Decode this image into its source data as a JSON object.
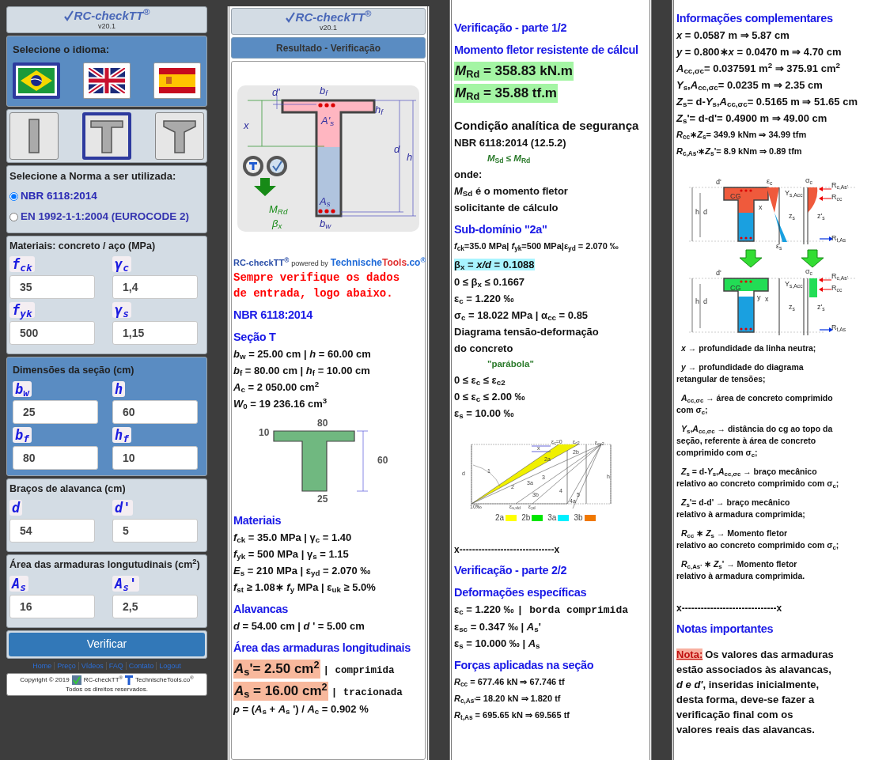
{
  "input_panel": {
    "header": {
      "title": "RC-checkTT$^{®}$",
      "version": "v20.1"
    },
    "language": {
      "label": "Selecione o idioma:",
      "flags": [
        {
          "kind": "brazil",
          "selected": true
        },
        {
          "kind": "uk",
          "selected": false
        },
        {
          "kind": "spain",
          "selected": false
        }
      ]
    },
    "sections": [
      {
        "kind": "rect",
        "selected": false
      },
      {
        "kind": "tee",
        "selected": true
      },
      {
        "kind": "tee-haunch",
        "selected": false
      }
    ],
    "norm": {
      "label": "Selecione a Norma a ser utilizada:",
      "options": [
        {
          "label": "NBR 6118:2014",
          "selected": true
        },
        {
          "label": "EN 1992-1-1:2004 (EUROCODE 2)",
          "selected": false
        }
      ]
    },
    "groups": [
      {
        "title": "Materiais: concreto / aço (MPa)",
        "highlighted": false,
        "fields": [
          {
            "symbol": "f$_{ck}$",
            "value": "35"
          },
          {
            "symbol": "γ$_{c}$",
            "value": "1,4"
          },
          {
            "symbol": "f$_{yk}$",
            "value": "500"
          },
          {
            "symbol": "γ$_{s}$",
            "value": "1,15"
          }
        ]
      },
      {
        "title": "Dimensões da seção (cm)",
        "highlighted": true,
        "fields": [
          {
            "symbol": "b$_{w}$",
            "value": "25"
          },
          {
            "symbol": "h",
            "value": "60"
          },
          {
            "symbol": "b$_{f}$",
            "value": "80"
          },
          {
            "symbol": "h$_{f}$",
            "value": "10"
          }
        ]
      },
      {
        "title": "Braços de alavanca (cm)",
        "highlighted": false,
        "fields": [
          {
            "symbol": "d",
            "value": "54"
          },
          {
            "symbol": "d'",
            "value": "5"
          }
        ]
      },
      {
        "title": "Área das armaduras longutudinais (cm$^{2}$)",
        "highlighted": false,
        "fields": [
          {
            "symbol": "A$_{s}$",
            "value": "16"
          },
          {
            "symbol": "A$_{s}$'",
            "value": "2,5"
          }
        ]
      }
    ],
    "button": "Verificar",
    "links": [
      "Home",
      "Preço",
      "Vídeos",
      "FAQ",
      "Contato",
      "Logout"
    ],
    "copyright": {
      "year": "Copyright © 2019",
      "app": "RC-checkTT$^{®}$",
      "site": "TechnischeTools.co$^{®}$",
      "rights": "Todos os direitos reservados."
    }
  },
  "results": {
    "header": {
      "title": "RC-checkTT$^{®}$",
      "version": "v20.1"
    },
    "title": "Resultado - Verificação",
    "columns": [
      [
        {
          "kind": "section-drawing",
          "labels": [
            "d'",
            "b$_{f}$",
            "h$_{f}$",
            "x",
            "A'$_{s}$",
            "d",
            "h",
            "A$_{s}$",
            "b$_{w}$",
            "M$_{Rd}$",
            "β$_{x}$"
          ]
        },
        {
          "kind": "credit",
          "app": "RC-checkTT$^{®}$",
          "by": "powered by",
          "site": "Technische",
          "site2": "Tools",
          "site3": ".co$^{®}$"
        },
        {
          "kind": "warning",
          "text": "Sempre verifique os dados\nde entrada, logo abaixo."
        },
        {
          "kind": "heading",
          "text": "NBR 6118:2014"
        },
        {
          "kind": "heading",
          "text": "Seção T"
        },
        {
          "kind": "line",
          "text": "*b*$_{w}$ = 25.00 cm | *h* = 60.00 cm"
        },
        {
          "kind": "line",
          "text": "*b*$_{f}$ = 80.00 cm | *h*$_{f}$ = 10.00 cm"
        },
        {
          "kind": "line",
          "text": "*A*$_{c}$ = 2 050.00 cm$^{2}$"
        },
        {
          "kind": "line",
          "text": "*W*$_{0}$ = 19 236.16 cm$^{3}$"
        },
        {
          "kind": "tee-drawing",
          "labels": [
            "80",
            "10",
            "60",
            "25"
          ]
        },
        {
          "kind": "heading",
          "text": "Materiais"
        },
        {
          "kind": "line",
          "text": "*f*$_{ck}$ = 35.0 MPa | γ$_{c}$ = 1.40"
        },
        {
          "kind": "line",
          "text": "*f*$_{yk}$ = 500 MPa | γ$_{s}$ = 1.15"
        },
        {
          "kind": "line",
          "text": "*E*$_{s}$ = 210 MPa | ε$_{yd}$ = 2.070 ‰"
        },
        {
          "kind": "line",
          "text": "*f*$_{st}$ ≥ 1.08∗ *f*$_{y}$ MPa | ε$_{uk}$ ≥ 5.0%"
        },
        {
          "kind": "heading",
          "text": "Alavancas"
        },
        {
          "kind": "line",
          "text": "*d* = 54.00 cm | *d* ' = 5.00 cm"
        },
        {
          "kind": "heading",
          "text": "Área das armaduras longitudinais"
        },
        {
          "kind": "result",
          "text": "*A*$_{s}$'= 2.50 cm$^{2}$",
          "note": "| comprimida",
          "color": "#f8b89c"
        },
        {
          "kind": "result",
          "text": "*A*$_{s}$ = 16.00 cm$^{2}$",
          "note": "| tracionada",
          "color": "#f8b89c"
        },
        {
          "kind": "line",
          "text": "*ρ* = (*A*$_{s}$ + *A*$_{s}$ ') / *A*$_{c}$ = 0.902 %"
        }
      ],
      [
        {
          "kind": "heading",
          "text": "Verificação - parte 1/2"
        },
        {
          "kind": "heading",
          "text": "Momento fletor resistente de cálcul"
        },
        {
          "kind": "result",
          "text": "*M*$_{Rd}$ = 358.83 kN.m",
          "color": "#a4f5a4"
        },
        {
          "kind": "result",
          "text": "*M*$_{Rd}$ = 35.88 tf.m",
          "color": "#a4f5a4"
        },
        {
          "kind": "subheading",
          "text": "Condição analítica de segurança"
        },
        {
          "kind": "line",
          "text": "NBR 6118:2014 (12.5.2)"
        },
        {
          "kind": "formula",
          "text": "*M*$_{Sd}$ ≤ *M*$_{Rd}$"
        },
        {
          "kind": "line",
          "text": "onde:"
        },
        {
          "kind": "line",
          "text": "*M*$_{Sd}$ é o momento fletor\nsolicitante de cálculo"
        },
        {
          "kind": "heading",
          "text": "Sub-domínio \"2a\""
        },
        {
          "kind": "small",
          "text": "*f*$_{ck}$=35.0 MPa| *f*$_{yk}$=500 MPa|ε$_{yd}$ = 2.070 ‰"
        },
        {
          "kind": "highlight",
          "text": "β$_{x}$ = *x/d* = 0.1088",
          "color": "#a8f4ff"
        },
        {
          "kind": "line",
          "text": "0 ≤ β$_{x}$ ≤ 0.1667"
        },
        {
          "kind": "line",
          "text": "ε$_{c}$ = 1.220 ‰"
        },
        {
          "kind": "line",
          "text": "σ$_{c}$ = 18.022 MPa | α$_{cc}$ = 0.85"
        },
        {
          "kind": "line",
          "text": "Diagrama tensão-deformação\ndo concreto"
        },
        {
          "kind": "formula",
          "text": "\"parábola\""
        },
        {
          "kind": "line",
          "text": "0 ≤ ε$_{c}$ ≤ ε$_{c2}$"
        },
        {
          "kind": "line",
          "text": "0 ≤ ε$_{c}$ ≤ 2.00 ‰"
        },
        {
          "kind": "line",
          "text": "ε$_{s}$ = 10.00 ‰"
        },
        {
          "kind": "domain-drawing",
          "labels": [
            "ε$_{c}$=0",
            "ε$_{c2}$",
            "ε$_{cu2}$",
            "x",
            "2b",
            "2a",
            "d",
            "1",
            "3",
            "h",
            "3a",
            "2",
            "4",
            "3b",
            "5",
            "4a",
            "10‰",
            "ε$_{s,xld}$",
            "ε$_{yd}$"
          ],
          "legend": [
            {
              "label": "2a",
              "color": "#ffff00"
            },
            {
              "label": "2b",
              "color": "#00e600"
            },
            {
              "label": "3a",
              "color": "#00f0ff"
            },
            {
              "label": "3b",
              "color": "#f07800"
            }
          ]
        },
        {
          "kind": "separator",
          "text": "x------------------------------x"
        },
        {
          "kind": "heading",
          "text": "Verificação - parte 2/2"
        },
        {
          "kind": "heading",
          "text": "Deformações específicas"
        },
        {
          "kind": "line",
          "text": "ε$_{c}$ = 1.220 ‰",
          "note": "| borda comprimida"
        },
        {
          "kind": "line",
          "text": "ε$_{sc}$ = 0.347 ‰ | *A*$_{s}$'"
        },
        {
          "kind": "line",
          "text": "ε$_{s}$ = 10.000 ‰ | *A*$_{s}$"
        },
        {
          "kind": "heading",
          "text": "Forças aplicadas na seção"
        },
        {
          "kind": "small",
          "text": "*R*$_{cc}$ = 677.46 kN ⇒ 67.746 tf"
        },
        {
          "kind": "small",
          "text": "*R*$_{c,As'}$= 18.20 kN ⇒ 1.820 tf"
        },
        {
          "kind": "small",
          "text": "*R*$_{t,As}$ = 695.65 kN ⇒ 69.565 tf"
        }
      ],
      [
        {
          "kind": "heading",
          "text": "Informações complementares"
        },
        {
          "kind": "line",
          "text": "*x* = 0.0587 m ⇒ 5.87 cm"
        },
        {
          "kind": "line",
          "text": "*y* = 0.800∗*x* = 0.0470 m ⇒ 4.70 cm"
        },
        {
          "kind": "line",
          "text": "*A*$_{cc,σc}$= 0.037591 m$^{2}$ ⇒ 375.91 cm$^{2}$"
        },
        {
          "kind": "line",
          "text": "*Y*$_{s}$,*A*$_{cc,σc}$= 0.0235 m ⇒ 2.35 cm"
        },
        {
          "kind": "line",
          "text": "*Z*$_{s}$= d-*Y*$_{s}$,*A*$_{cc,σc}$= 0.5165 m ⇒ 51.65 cm"
        },
        {
          "kind": "line",
          "text": "*Z*$_{s}$'= d-d'= 0.4900 m ⇒ 49.00 cm"
        },
        {
          "kind": "small",
          "text": "*R*$_{cc}$∗*Z*$_{s}$= 349.9 kNm ⇒ 34.99 tfm"
        },
        {
          "kind": "small",
          "text": "*R*$_{c,As'}$∗*Z*$_{s}$'= 8.9 kNm ⇒ 0.89 tfm"
        },
        {
          "kind": "stress-drawing",
          "labels": [
            "d'",
            "h",
            "d",
            "CG",
            "x",
            "ε$_{c}$",
            "σ$_{c}$",
            "Y$_{s,Acc}$",
            "R$_{c,As'}$",
            "R$_{cc}$",
            "z$_{s}$",
            "z'$_{s}$",
            "ε$_{s}$",
            "R$_{t,As}$",
            "d'",
            "h",
            "d",
            "CG",
            "y",
            "x",
            "σ$_{c}$",
            "Y$_{s,Acc}$",
            "R$_{c,As'}$",
            "R$_{cc}$",
            "z$_{s}$",
            "z'$_{s}$",
            "R$_{t,As}$"
          ]
        },
        {
          "kind": "definition",
          "text": "*x* → profundidade da linha neutra;"
        },
        {
          "kind": "definition",
          "text": "*y* → profundidade do diagrama\nretangular de tensões;"
        },
        {
          "kind": "definition",
          "text": "*A*$_{cc,σc}$ → área de concreto comprimido\ncom σ$_{c}$;"
        },
        {
          "kind": "definition",
          "text": "*Y*$_{s}$,*A*$_{cc,σc}$ → distância do cg ao topo da\nseção, referente à área de concreto\ncomprimido com σ$_{c}$;"
        },
        {
          "kind": "definition",
          "text": "*Z*$_{s}$ = d-*Y*$_{s}$,*A*$_{cc,σc}$ → braço mecânico\nrelativo ao concreto comprimido com σ$_{c}$;"
        },
        {
          "kind": "definition",
          "text": "*Z*$_{s}$'= d-d' → braço mecânico\nrelativo à armadura comprimida;"
        },
        {
          "kind": "definition",
          "text": "*R*$_{cc}$ ∗ *Z*$_{s}$ → Momento fletor\nrelativo ao concreto comprimido com σ$_{c}$;"
        },
        {
          "kind": "definition",
          "text": "*R*$_{c,As'}$ ∗ *Z*$_{s}$' → Momento fletor\nrelativo à armadura comprimida."
        },
        {
          "kind": "separator",
          "text": "x------------------------------x"
        },
        {
          "kind": "heading",
          "text": "Notas importantes"
        },
        {
          "kind": "note",
          "label": "Nota:",
          "text": "Os valores das armaduras\nestão associados às alavancas,\n*d e d'*, inseridas inicialmente,\ndesta forma, deve-se fazer a\nverificação final com os\nvalores reais das alavancas."
        }
      ]
    ]
  }
}
